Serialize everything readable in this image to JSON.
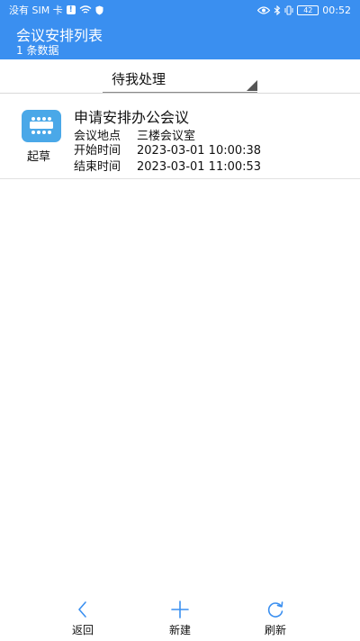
{
  "status_bar": {
    "carrier": "没有 SIM 卡",
    "battery": "42",
    "time": "00:52"
  },
  "header": {
    "title": "会议安排列表",
    "count": "1 条数据"
  },
  "filter": {
    "selected": "待我处理"
  },
  "meetings": [
    {
      "title": "申请安排办公会议",
      "status": "起草",
      "location_label": "会议地点",
      "location": "三楼会议室",
      "start_label": "开始时间",
      "start": "2023-03-01 10:00:38",
      "end_label": "结束时间",
      "end": "2023-03-01 11:00:53"
    }
  ],
  "bottom_bar": {
    "back": "返回",
    "new": "新建",
    "refresh": "刷新"
  },
  "colors": {
    "primary": "#3a8ff0",
    "icon_accent": "#4aa8e8"
  },
  "icons": {
    "back": "chevron-left-icon",
    "new": "plus-icon",
    "refresh": "refresh-icon",
    "app": "meeting-table-icon"
  }
}
